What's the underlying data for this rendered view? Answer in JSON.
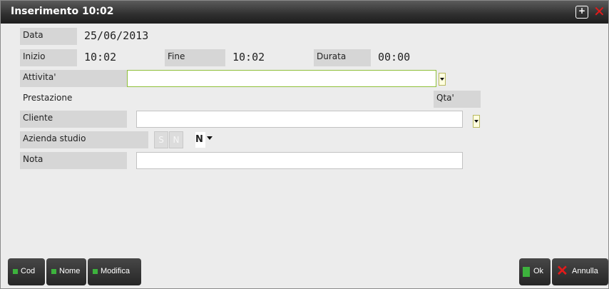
{
  "window": {
    "title": "Inserimento 10:02"
  },
  "form": {
    "data_label": "Data",
    "data_value": "25/06/2013",
    "inizio_label": "Inizio",
    "inizio_value": "10:02",
    "fine_label": "Fine",
    "fine_value": "10:02",
    "durata_label": "Durata",
    "durata_value": "00:00",
    "attivita_label": "Attivita'",
    "attivita_value": "",
    "prestazione_label": "Prestazione",
    "qta_label": "Qta'",
    "cliente_label": "Cliente",
    "cliente_value": "",
    "azienda_label": "Azienda studio",
    "toggle_s": "S",
    "toggle_n": "N",
    "azienda_value": "N",
    "nota_label": "Nota",
    "nota_value": ""
  },
  "footer": {
    "cod_label": "Cod",
    "nome_label": "Nome",
    "modifica_label": "Modifica",
    "ok_label": "Ok",
    "annulla_label": "Annulla"
  },
  "colors": {
    "accent_green": "#3db23d",
    "close_red": "#e21a1a",
    "active_field_border": "#8fc03a"
  },
  "icons": {
    "maximize": "plus-in-box",
    "close": "red-x",
    "dropdown": "triangle-down"
  }
}
